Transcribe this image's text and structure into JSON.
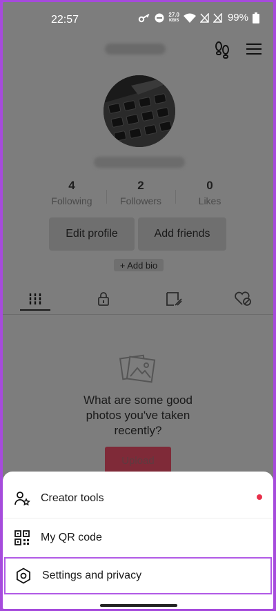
{
  "status_bar": {
    "time": "22:57",
    "net_speed_value": "27.0",
    "net_speed_unit": "KB/S",
    "battery": "99%"
  },
  "profile": {
    "stats": [
      {
        "num": "4",
        "label": "Following"
      },
      {
        "num": "2",
        "label": "Followers"
      },
      {
        "num": "0",
        "label": "Likes"
      }
    ],
    "edit_profile": "Edit profile",
    "add_friends": "Add friends",
    "add_bio": "+ Add bio"
  },
  "tabs": [
    "videos-grid-icon",
    "lock-icon",
    "bookmark-icon",
    "liked-hidden-icon"
  ],
  "empty_state": {
    "text": "What are some good photos you've taken recently?",
    "upload": "Upload"
  },
  "sheet": {
    "items": [
      {
        "label": "Creator tools",
        "icon": "creator-tools-icon"
      },
      {
        "label": "My QR code",
        "icon": "qr-code-icon"
      },
      {
        "label": "Settings and privacy",
        "icon": "settings-gear-icon"
      }
    ]
  },
  "colors": {
    "overlay": "#7d7d7d",
    "highlight": "#b15ae6",
    "notification_dot": "#e8304b"
  }
}
